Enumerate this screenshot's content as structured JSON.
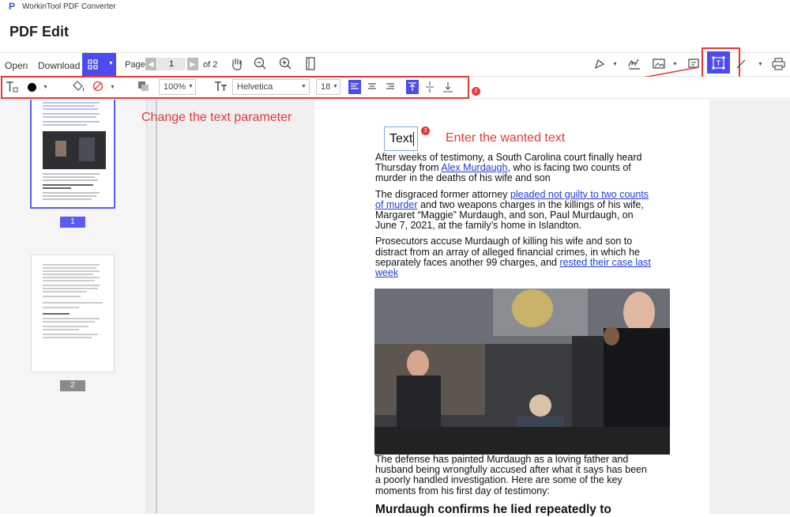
{
  "app": {
    "title": "WorkinTool PDF Converter",
    "page_heading": "PDF Edit"
  },
  "toolbar": {
    "open_label": "Open",
    "download_label": "Download",
    "page_label": "Page",
    "current_page": "1",
    "page_total": "of 2"
  },
  "format_toolbar": {
    "zoom": "100%",
    "font": "Helvetica",
    "font_size": "18"
  },
  "annotations": {
    "badge1": "1",
    "badge2": "2",
    "badge3": "3",
    "change_text": "Change the text parameter",
    "enter_text": "Enter the wanted text"
  },
  "sidebar": {
    "pages": [
      {
        "label": "1"
      },
      {
        "label": "2"
      }
    ]
  },
  "document": {
    "text_box": "Text",
    "p1_a": "After weeks of testimony, a South Carolina court finally heard Thursday from ",
    "p1_link": "Alex Murdaugh",
    "p1_b": ", who is facing two counts of murder in the deaths of his wife and son",
    "p2_a": "The disgraced former attorney ",
    "p2_link": "pleaded not guilty to two counts of murder",
    "p2_b": " and two weapons charges in the killings of his wife, Margaret “Maggie” Murdaugh, and son, Paul Murdaugh, on June 7, 2021, at the family’s home in Islandton.",
    "p3_a": "Prosecutors accuse Murdaugh of killing his wife and son to distract from an array of alleged financial crimes, in which he separately faces another 99 charges, and ",
    "p3_link": "rested their case last week",
    "p4": "The defense has painted Murdaugh as a loving father and husband being wrongfully accused after what it says has been a poorly handled investigation. Here are some of the key moments from his first day of testimony:",
    "heading": "Murdaugh confirms he lied repeatedly to"
  },
  "colors": {
    "accent": "#4b4bf0",
    "annotation": "#e53935",
    "link": "#1f3bd6"
  }
}
